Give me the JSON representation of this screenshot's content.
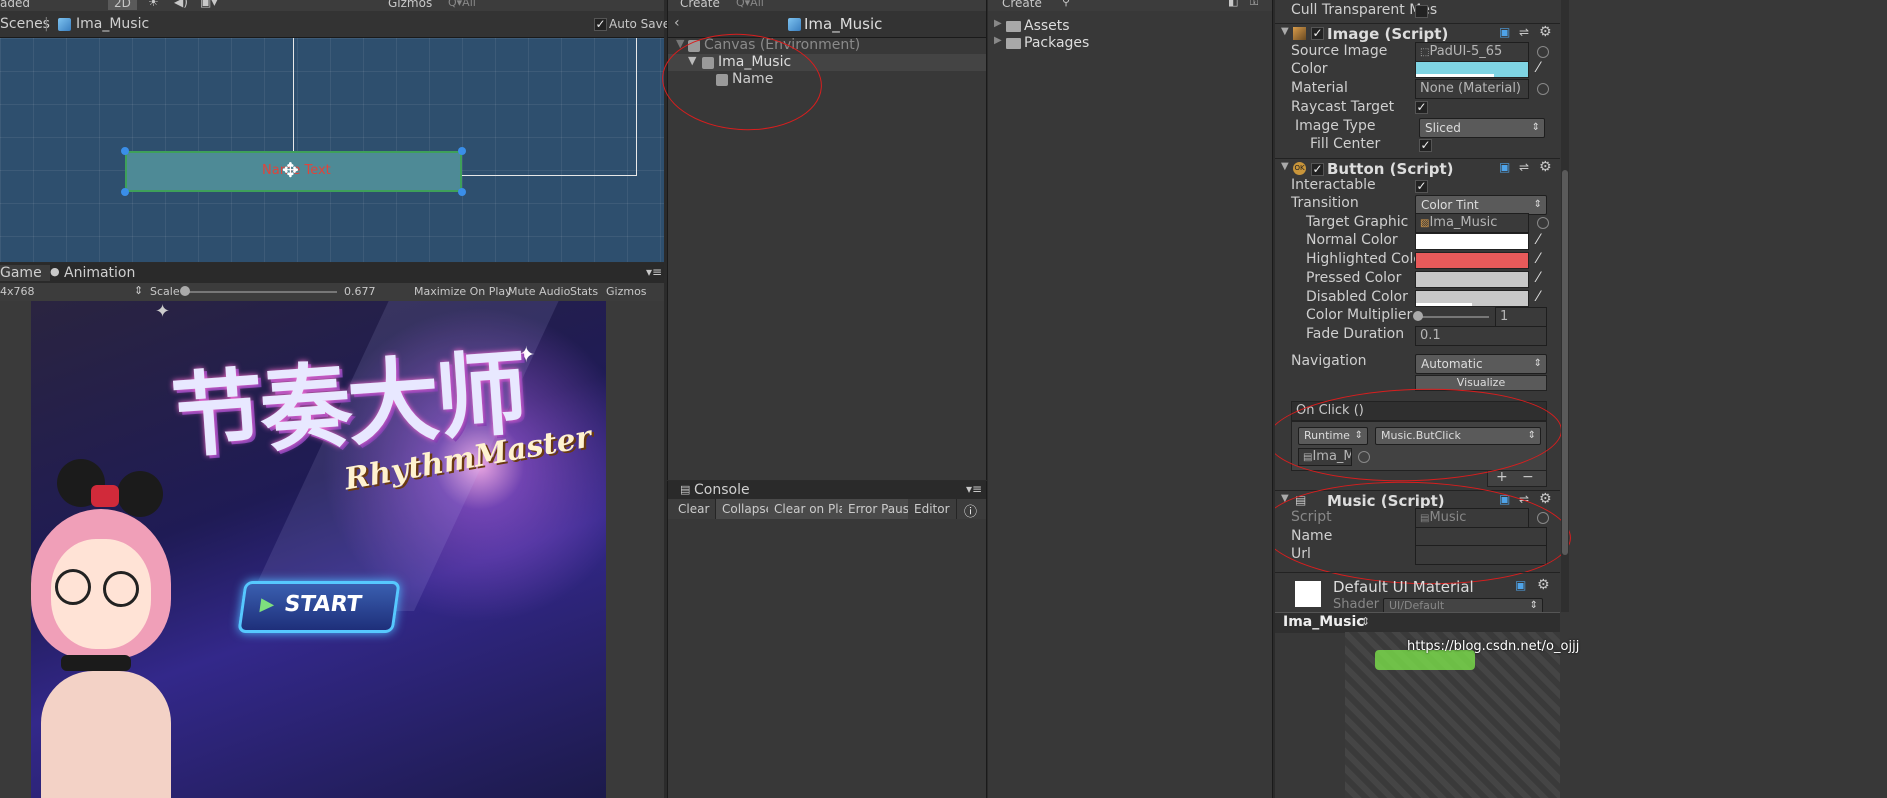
{
  "scene": {
    "toolbar": {
      "shaded": "aded",
      "btn_2d": "2D",
      "gizmos": "Gizmos",
      "search_placeholder": "Q▾All"
    },
    "breadcrumb": {
      "scenes": "Scenes",
      "separator": "|",
      "object": "Ima_Music"
    },
    "auto_save": "Auto Save",
    "object_label": "Name Text"
  },
  "game": {
    "tabs": {
      "game": "Game",
      "animation": "Animation"
    },
    "toolbar": {
      "resolution": "4x768",
      "scale_label": "Scale",
      "scale_value": "0.677",
      "maximize": "Maximize On Play",
      "mute": "Mute Audio",
      "stats": "Stats",
      "gizmos": "Gizmos"
    },
    "art": {
      "title_cn": "节奏大师",
      "title_en": "RhythmMaster",
      "start": "START"
    }
  },
  "hierarchy": {
    "create": "Create",
    "search_placeholder": "Q▾All",
    "title": "Ima_Music",
    "items": [
      {
        "label": "Canvas (Environment)"
      },
      {
        "label": "Ima_Music"
      },
      {
        "label": "Name"
      }
    ]
  },
  "console": {
    "tab": "Console",
    "buttons": {
      "clear": "Clear",
      "collapse": "Collapse",
      "clear_on_play": "Clear on Play",
      "error_pause": "Error Pause",
      "editor": "Editor"
    }
  },
  "project": {
    "create": "Create",
    "items": [
      {
        "label": "Assets"
      },
      {
        "label": "Packages"
      }
    ]
  },
  "inspector": {
    "cull_transparent": "Cull Transparent Mes",
    "image": {
      "title": "Image (Script)",
      "source_image_label": "Source Image",
      "source_image_value": "PadUI-5_65",
      "color_label": "Color",
      "color_value": "#7fd4e3",
      "material_label": "Material",
      "material_value": "None (Material)",
      "raycast_label": "Raycast Target",
      "image_type_label": "Image Type",
      "image_type_value": "Sliced",
      "fill_center_label": "Fill Center"
    },
    "button": {
      "title": "Button (Script)",
      "interactable_label": "Interactable",
      "transition_label": "Transition",
      "transition_value": "Color Tint",
      "target_graphic_label": "Target Graphic",
      "target_graphic_value": "Ima_Music (Imag",
      "normal_label": "Normal Color",
      "normal_value": "#ffffff",
      "highlighted_label": "Highlighted Color",
      "highlighted_value": "#e85a5a",
      "pressed_label": "Pressed Color",
      "pressed_value": "#c8c8c8",
      "disabled_label": "Disabled Color",
      "disabled_value": "#c8c8c8",
      "multiplier_label": "Color Multiplier",
      "multiplier_value": "1",
      "fade_label": "Fade Duration",
      "fade_value": "0.1",
      "navigation_label": "Navigation",
      "navigation_value": "Automatic",
      "visualize": "Visualize",
      "onclick_title": "On Click ()",
      "runtime_value": "Runtime On",
      "function_value": "Music.ButClick",
      "object_value": "Ima_M",
      "plus": "+",
      "minus": "−"
    },
    "music": {
      "title": "Music (Script)",
      "script_label": "Script",
      "script_value": "Music",
      "name_label": "Name",
      "url_label": "Url"
    },
    "material": {
      "title": "Default UI Material",
      "shader_label": "Shader",
      "shader_value": "UI/Default"
    },
    "footer_object": "Ima_Music",
    "watermark": "https://blog.csdn.net/o_ojjj"
  }
}
